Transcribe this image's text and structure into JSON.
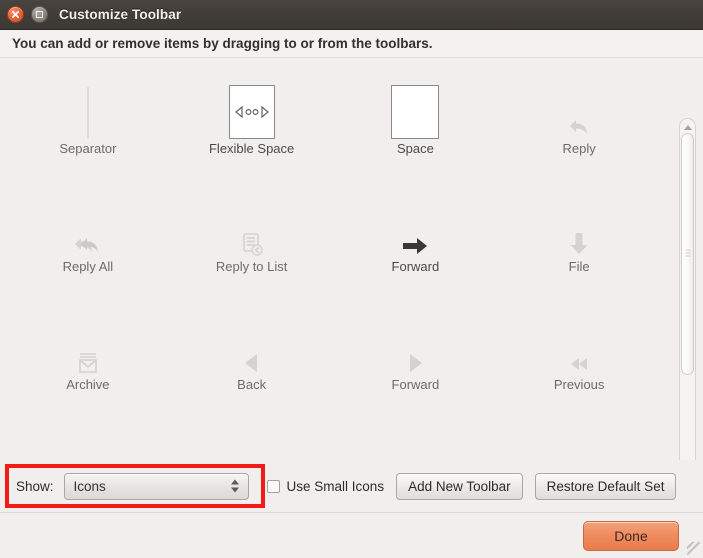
{
  "window": {
    "title": "Customize Toolbar",
    "close_icon": "close-icon",
    "maximize_icon": "maximize-icon"
  },
  "instruction": "You can add or remove items by dragging to or from the toolbars.",
  "palette": {
    "items": [
      {
        "label": "Separator",
        "icon": "separator-icon",
        "state": "dim"
      },
      {
        "label": "Flexible Space",
        "icon": "flexible-space-icon",
        "state": "normal"
      },
      {
        "label": "Space",
        "icon": "space-icon",
        "state": "normal"
      },
      {
        "label": "Reply",
        "icon": "reply-icon",
        "state": "dim"
      },
      {
        "label": "Reply All",
        "icon": "reply-all-icon",
        "state": "dim"
      },
      {
        "label": "Reply to List",
        "icon": "reply-to-list-icon",
        "state": "dim"
      },
      {
        "label": "Forward",
        "icon": "forward-arrow-icon",
        "state": "enabled"
      },
      {
        "label": "File",
        "icon": "file-down-arrow-icon",
        "state": "dim"
      },
      {
        "label": "Archive",
        "icon": "archive-icon",
        "state": "dim"
      },
      {
        "label": "Back",
        "icon": "back-triangle-icon",
        "state": "dim"
      },
      {
        "label": "Forward",
        "icon": "forward-triangle-icon",
        "state": "dim"
      },
      {
        "label": "Previous",
        "icon": "previous-double-icon",
        "state": "dim"
      },
      {
        "label": "",
        "icon": "chart-icon",
        "state": "dim"
      },
      {
        "label": "",
        "icon": "print-icon",
        "state": "dim"
      },
      {
        "label": "",
        "icon": "minus-icon",
        "state": "dim"
      },
      {
        "label": "",
        "icon": "junk-icon",
        "state": "dim"
      }
    ]
  },
  "scrollbar": {
    "up_icon": "scroll-up-arrow-icon",
    "down_icon": "scroll-down-arrow-icon",
    "thumb_icon": "scrollbar-thumb"
  },
  "controls": {
    "show_label": "Show:",
    "show_value": "Icons",
    "show_options": [
      "Icons"
    ],
    "small_icons_label": "Use Small Icons",
    "small_icons_checked": false,
    "add_toolbar_label": "Add New Toolbar",
    "restore_defaults_label": "Restore Default Set"
  },
  "footer": {
    "done_label": "Done"
  },
  "annotation": {
    "highlight_color": "#f41b16"
  }
}
